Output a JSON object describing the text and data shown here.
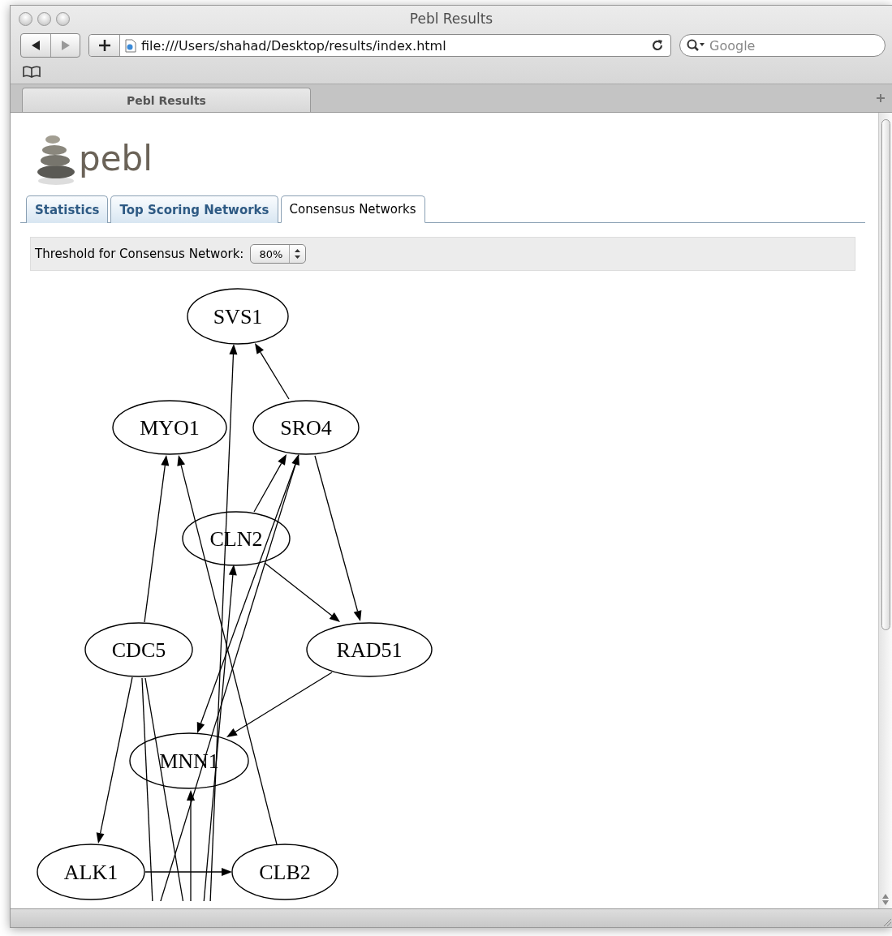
{
  "window": {
    "title": "Pebl Results"
  },
  "toolbar": {
    "url": "file:///Users/shahad/Desktop/results/index.html",
    "search": {
      "placeholder": "Google"
    }
  },
  "browser_tabs": [
    {
      "label": "Pebl Results",
      "selected": true
    }
  ],
  "page": {
    "logo": "pebl",
    "tabs": [
      {
        "label": "Statistics",
        "selected": false
      },
      {
        "label": "Top Scoring Networks",
        "selected": false
      },
      {
        "label": "Consensus Networks",
        "selected": true
      }
    ],
    "threshold": {
      "label": "Threshold for Consensus Network:",
      "value": "80%"
    },
    "network": {
      "nodes": [
        {
          "label": "SVS1"
        },
        {
          "label": "MYO1"
        },
        {
          "label": "SRO4"
        },
        {
          "label": "CLN2"
        },
        {
          "label": "CDC5"
        },
        {
          "label": "RAD51"
        },
        {
          "label": "MNN1"
        },
        {
          "label": "ALK1"
        },
        {
          "label": "CLB2"
        }
      ]
    }
  }
}
